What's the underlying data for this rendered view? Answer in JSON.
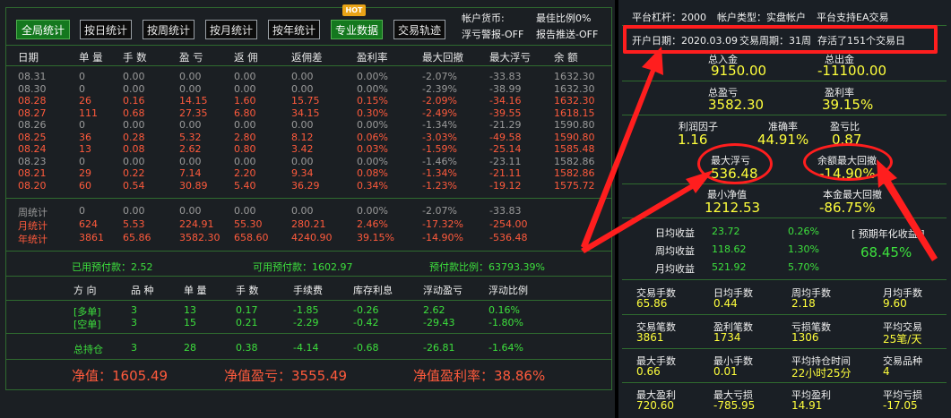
{
  "toolbar": {
    "buttons": [
      "全局统计",
      "按日统计",
      "按周统计",
      "按月统计",
      "按年统计",
      "专业数据",
      "交易轨迹"
    ],
    "hot": "HOT",
    "info": [
      "帐户货币:",
      "浮亏警报-OFF",
      "最佳比例0%",
      "报告推送-OFF"
    ]
  },
  "table": {
    "headers": [
      "日期",
      "单 量",
      "手 数",
      "盈 亏",
      "返 佣",
      "返佣差",
      "盈利率",
      "最大回撤",
      "最大浮亏",
      "余 额"
    ],
    "rows": [
      {
        "style": "gray",
        "cells": [
          "08.31",
          "0",
          "0.00",
          "0.00",
          "0.00",
          "0.00",
          "0.00%",
          "-2.07%",
          "-33.83",
          "1632.30"
        ]
      },
      {
        "style": "gray",
        "cells": [
          "08.30",
          "0",
          "0.00",
          "0.00",
          "0.00",
          "0.00",
          "0.00%",
          "-2.39%",
          "-38.99",
          "1632.30"
        ]
      },
      {
        "style": "red",
        "cells": [
          "08.28",
          "26",
          "0.16",
          "14.15",
          "1.60",
          "15.75",
          "0.15%",
          "-2.09%",
          "-34.16",
          "1632.30"
        ]
      },
      {
        "style": "red",
        "cells": [
          "08.27",
          "111",
          "0.68",
          "27.35",
          "6.80",
          "34.15",
          "0.30%",
          "-2.49%",
          "-39.55",
          "1618.15"
        ]
      },
      {
        "style": "gray",
        "cells": [
          "08.26",
          "0",
          "0.00",
          "0.00",
          "0.00",
          "0.00",
          "0.00%",
          "-1.34%",
          "-21.29",
          "1590.80"
        ]
      },
      {
        "style": "red",
        "cells": [
          "08.25",
          "36",
          "0.28",
          "5.32",
          "2.80",
          "8.12",
          "0.06%",
          "-3.03%",
          "-49.58",
          "1590.80"
        ]
      },
      {
        "style": "red",
        "cells": [
          "08.24",
          "13",
          "0.08",
          "2.62",
          "0.80",
          "3.42",
          "0.03%",
          "-1.59%",
          "-25.14",
          "1585.48"
        ]
      },
      {
        "style": "gray",
        "cells": [
          "08.23",
          "0",
          "0.00",
          "0.00",
          "0.00",
          "0.00",
          "0.00%",
          "-1.46%",
          "-23.11",
          "1582.86"
        ]
      },
      {
        "style": "red",
        "cells": [
          "08.21",
          "29",
          "0.22",
          "7.14",
          "2.20",
          "9.34",
          "0.08%",
          "-1.34%",
          "-21.11",
          "1582.86"
        ]
      },
      {
        "style": "red",
        "cells": [
          "08.20",
          "60",
          "0.54",
          "30.89",
          "5.40",
          "36.29",
          "0.34%",
          "-1.23%",
          "-19.12",
          "1575.72"
        ]
      }
    ],
    "summary": [
      {
        "style": "gray",
        "cells": [
          "周统计",
          "0",
          "0.00",
          "0.00",
          "0.00",
          "0.00",
          "0.00%",
          "-2.07%",
          "-33.83",
          ""
        ]
      },
      {
        "style": "red",
        "cells": [
          "月统计",
          "624",
          "5.53",
          "224.91",
          "55.30",
          "280.21",
          "2.46%",
          "-17.32%",
          "-254.00",
          ""
        ]
      },
      {
        "style": "red",
        "cells": [
          "年统计",
          "3861",
          "65.86",
          "3582.30",
          "658.60",
          "4240.90",
          "39.15%",
          "-14.90%",
          "-536.48",
          ""
        ]
      }
    ]
  },
  "margin": {
    "used": "已用预付款：2.52",
    "free": "可用预付款：1602.97",
    "ratio": "预付款比例：63793.39%"
  },
  "positions": {
    "headers": [
      "方 向",
      "品 种",
      "单 量",
      "手 数",
      "手续费",
      "库存利息",
      "浮动盈亏",
      "浮动比例"
    ],
    "rows": [
      [
        "[多单]",
        "3",
        "13",
        "0.17",
        "-1.85",
        "-0.26",
        "2.62",
        "0.16%"
      ],
      [
        "[空单]",
        "3",
        "15",
        "0.21",
        "-2.29",
        "-0.42",
        "-29.43",
        "-1.80%"
      ]
    ],
    "total": [
      "总持仓",
      "3",
      "28",
      "0.38",
      "-4.14",
      "-0.68",
      "-26.81",
      "-1.64%"
    ]
  },
  "netvalue": {
    "value": "净值：1605.49",
    "pnl": "净值盈亏：3555.49",
    "rate": "净值盈利率：38.86%"
  },
  "right": {
    "top": [
      "平台杠杆：2000",
      "帐户类型：实盘帐户",
      "平台支持EA交易"
    ],
    "open": [
      "开户日期：2020.03.09",
      "交易周期：31周",
      "存活了151个交易日"
    ],
    "deposit_value": "9150.00",
    "withdraw_value": "-11100.00",
    "deposit_label": "总入金",
    "withdraw_label": "总出金",
    "total_pnl_label": "总盈亏",
    "total_pnl": "3582.30",
    "profit_rate_label": "盈利率",
    "profit_rate": "39.15%",
    "pf_label": "利润因子",
    "pf": "1.16",
    "acc_label": "准确率",
    "acc": "44.91%",
    "ratio_label": "盈亏比",
    "ratio": "0.87",
    "max_float_label": "最大浮亏",
    "max_float": "536.48",
    "max_dd_label": "余额最大回撤",
    "max_dd": "-14.90%",
    "min_net_label": "最小净值",
    "min_net": "1212.53",
    "cap_dd_label": "本金最大回撤",
    "cap_dd": "-86.75%",
    "avg": [
      {
        "label": "日均收益",
        "value": "23.72",
        "pct": "0.26%"
      },
      {
        "label": "周均收益",
        "value": "118.62",
        "pct": "1.30%"
      },
      {
        "label": "月均收益",
        "value": "521.92",
        "pct": "5.70%"
      }
    ],
    "annual_label": "[ 预期年化收益 ]",
    "annual": "68.45%",
    "stats": [
      [
        {
          "l": "交易手数",
          "v": "65.86"
        },
        {
          "l": "日均手数",
          "v": "0.44"
        },
        {
          "l": "周均手数",
          "v": "2.18"
        },
        {
          "l": "月均手数",
          "v": "9.60"
        }
      ],
      [
        {
          "l": "交易笔数",
          "v": "3861"
        },
        {
          "l": "盈利笔数",
          "v": "1734"
        },
        {
          "l": "亏损笔数",
          "v": "1306"
        },
        {
          "l": "平均交易",
          "v": "25笔/天"
        }
      ],
      [
        {
          "l": "最大手数",
          "v": "0.66"
        },
        {
          "l": "最小手数",
          "v": "0.01"
        },
        {
          "l": "平均持仓时间",
          "v": "22小时25分"
        },
        {
          "l": "交易品种",
          "v": "4"
        }
      ],
      [
        {
          "l": "最大盈利",
          "v": "720.60"
        },
        {
          "l": "最大亏损",
          "v": "-785.95"
        },
        {
          "l": "平均盈利",
          "v": "14.91"
        },
        {
          "l": "平均亏损",
          "v": "-17.05"
        }
      ]
    ]
  },
  "colors": {
    "accent": "#14781e",
    "profit": "#ff5a3c",
    "loss": "#3de03d",
    "value": "#ffff3c",
    "annotation": "#ff1e1e"
  }
}
